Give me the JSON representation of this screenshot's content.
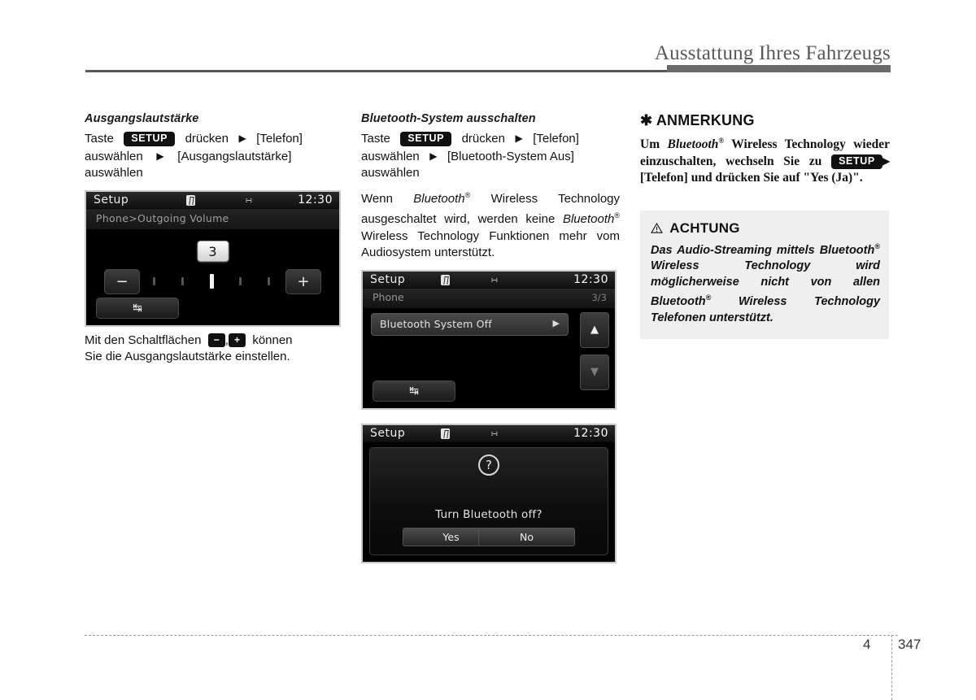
{
  "header": {
    "title": "Ausstattung Ihres Fahrzeugs"
  },
  "left_column": {
    "heading": "Ausgangslautstärke",
    "instruction": {
      "word_taste": "Taste",
      "setup_label": "SETUP",
      "word_druecken": "drücken",
      "arrow": "▶",
      "item1": "[Telefon]",
      "word_auswaehlen_1": "auswählen",
      "item2": "[Ausgangslautstärke]",
      "word_auswaehlen_2": "auswählen"
    },
    "screen": {
      "title": "Setup",
      "clock": "12:30",
      "breadcrumb": "Phone>Outgoing Volume",
      "value": "3",
      "minus_label": "−",
      "plus_label": "+",
      "back_label": "↹",
      "ticks_total": 5,
      "tick_active_index": 2,
      "bt_icon": "bluetooth-icon",
      "usb_icon": "usb-icon"
    },
    "caption": {
      "part1": "Mit den Schaltflächen",
      "minus": "−",
      "comma": ",",
      "plus": "+",
      "part2": "können",
      "part3": "Sie die Ausgangslautstärke einstellen."
    }
  },
  "mid_column": {
    "heading": "Bluetooth-System ausschalten",
    "instruction": {
      "word_taste": "Taste",
      "setup_label": "SETUP",
      "word_druecken": "drücken",
      "arrow": "▶",
      "item1": "[Telefon]",
      "word_auswaehlen_1": "auswählen",
      "item2": "[Bluetooth-System Aus]",
      "word_auswaehlen_2": "auswählen"
    },
    "paragraph": {
      "l1_a": "Wenn",
      "l1_bt": "Bluetooth",
      "l1_sup": "®",
      "l1_b": "Wireless Technology",
      "l2": "ausgeschaltet wird, werden keine",
      "l3_bt": "Bluetooth",
      "l3_sup": "®",
      "l3_b": "Wireless Technology",
      "l4": "Funktionen mehr vom Audiosystem",
      "l5": "unterstützt."
    },
    "list_screen": {
      "title": "Setup",
      "clock": "12:30",
      "breadcrumb": "Phone",
      "page_indicator": "3/3",
      "row_label": "Bluetooth System Off",
      "row_caret": "▶",
      "scroll_up": "▲",
      "scroll_down": "▼",
      "back_label": "↹"
    },
    "dialog_screen": {
      "title": "Setup",
      "clock": "12:30",
      "question_icon": "?",
      "message": "Turn Bluetooth off?",
      "yes_label": "Yes",
      "no_label": "No"
    }
  },
  "right_column": {
    "note": {
      "marker": "✱",
      "title": "ANMERKUNG",
      "l1_a": "Um",
      "l1_bt": "Bluetooth",
      "l1_sup": "®",
      "l1_b": "Wireless Technology",
      "l2": "wieder einzuschalten, wechseln Sie zu",
      "setup_label": "SETUP",
      "arrow": "▶",
      "l3_b": "[Telefon] und drücken Sie auf",
      "l4": "\"Yes (Ja)\"."
    },
    "warning": {
      "icon": "warning-triangle-icon",
      "title": "ACHTUNG",
      "l1": "Das Audio-Streaming mittels",
      "l2_bt": "Bluetooth",
      "l2_sup": "®",
      "l2_b": "Wireless Technology",
      "l3": "wird möglicherweise nicht von allen",
      "l4_bt": "Bluetooth",
      "l4_sup": "®",
      "l4_b": "Wireless Technology",
      "l5": "Telefonen unterstützt."
    }
  },
  "footer": {
    "chapter": "4",
    "page": "347"
  },
  "colors": {
    "header_text": "#58585a",
    "rule": "#6a6a6c",
    "warn_bg": "#efefef",
    "screen_bg": "#000000"
  }
}
